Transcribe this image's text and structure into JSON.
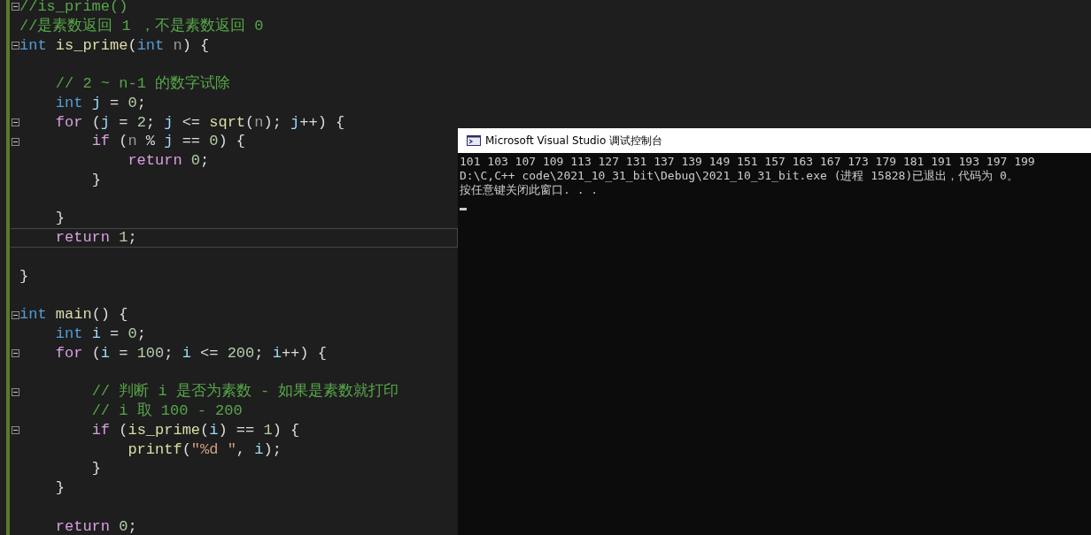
{
  "editor": {
    "lines": [
      {
        "fold": true,
        "current": false,
        "tokens": [
          {
            "kind": "comment",
            "text": "//is_prime()"
          }
        ]
      },
      {
        "fold": false,
        "current": false,
        "tokens": [
          {
            "kind": "comment",
            "text": "//是素数返回 1 ，不是素数返回 0"
          }
        ]
      },
      {
        "fold": true,
        "current": false,
        "tokens": [
          {
            "kind": "keyword",
            "text": "int"
          },
          {
            "kind": "function",
            "text": " is_prime"
          },
          {
            "kind": "plain",
            "text": "("
          },
          {
            "kind": "keyword",
            "text": "int"
          },
          {
            "kind": "param",
            "text": " n"
          },
          {
            "kind": "plain",
            "text": ") {"
          }
        ]
      },
      {
        "fold": false,
        "current": false
      },
      {
        "fold": false,
        "current": false,
        "tokens": [
          {
            "kind": "comment",
            "text": "    // 2 ~ n-1 的数字试除"
          }
        ]
      },
      {
        "fold": false,
        "current": false,
        "tokens": [
          {
            "kind": "keyword",
            "text": "    int"
          },
          {
            "kind": "variable",
            "text": " j"
          },
          {
            "kind": "plain",
            "text": " = "
          },
          {
            "kind": "number",
            "text": "0"
          },
          {
            "kind": "plain",
            "text": ";"
          }
        ]
      },
      {
        "fold": true,
        "current": false,
        "tokens": [
          {
            "kind": "control",
            "text": "    for"
          },
          {
            "kind": "plain",
            "text": " ("
          },
          {
            "kind": "variable",
            "text": "j"
          },
          {
            "kind": "plain",
            "text": " = "
          },
          {
            "kind": "number",
            "text": "2"
          },
          {
            "kind": "plain",
            "text": "; "
          },
          {
            "kind": "variable",
            "text": "j"
          },
          {
            "kind": "plain",
            "text": " <= "
          },
          {
            "kind": "function",
            "text": "sqrt"
          },
          {
            "kind": "plain",
            "text": "("
          },
          {
            "kind": "param",
            "text": "n"
          },
          {
            "kind": "plain",
            "text": "); "
          },
          {
            "kind": "variable",
            "text": "j"
          },
          {
            "kind": "plain",
            "text": "++) {"
          }
        ]
      },
      {
        "fold": true,
        "current": false,
        "tokens": [
          {
            "kind": "control",
            "text": "        if"
          },
          {
            "kind": "plain",
            "text": " ("
          },
          {
            "kind": "param",
            "text": "n"
          },
          {
            "kind": "plain",
            "text": " % "
          },
          {
            "kind": "variable",
            "text": "j"
          },
          {
            "kind": "plain",
            "text": " == "
          },
          {
            "kind": "number",
            "text": "0"
          },
          {
            "kind": "plain",
            "text": ") {"
          }
        ]
      },
      {
        "fold": false,
        "current": false,
        "tokens": [
          {
            "kind": "control",
            "text": "            return"
          },
          {
            "kind": "number",
            "text": " 0"
          },
          {
            "kind": "plain",
            "text": ";"
          }
        ]
      },
      {
        "fold": false,
        "current": false,
        "tokens": [
          {
            "kind": "plain",
            "text": "        }"
          }
        ]
      },
      {
        "fold": false,
        "current": false
      },
      {
        "fold": false,
        "current": false,
        "tokens": [
          {
            "kind": "plain",
            "text": "    }"
          }
        ]
      },
      {
        "fold": false,
        "current": true,
        "tokens": [
          {
            "kind": "control",
            "text": "    return"
          },
          {
            "kind": "number",
            "text": " 1"
          },
          {
            "kind": "plain",
            "text": ";"
          }
        ]
      },
      {
        "fold": false,
        "current": false
      },
      {
        "fold": false,
        "current": false,
        "tokens": [
          {
            "kind": "plain",
            "text": "}"
          }
        ]
      },
      {
        "fold": false,
        "current": false
      },
      {
        "fold": true,
        "current": false,
        "tokens": [
          {
            "kind": "keyword",
            "text": "int"
          },
          {
            "kind": "function",
            "text": " main"
          },
          {
            "kind": "plain",
            "text": "() {"
          }
        ]
      },
      {
        "fold": false,
        "current": false,
        "tokens": [
          {
            "kind": "keyword",
            "text": "    int"
          },
          {
            "kind": "variable",
            "text": " i"
          },
          {
            "kind": "plain",
            "text": " = "
          },
          {
            "kind": "number",
            "text": "0"
          },
          {
            "kind": "plain",
            "text": ";"
          }
        ]
      },
      {
        "fold": true,
        "current": false,
        "tokens": [
          {
            "kind": "control",
            "text": "    for"
          },
          {
            "kind": "plain",
            "text": " ("
          },
          {
            "kind": "variable",
            "text": "i"
          },
          {
            "kind": "plain",
            "text": " = "
          },
          {
            "kind": "number",
            "text": "100"
          },
          {
            "kind": "plain",
            "text": "; "
          },
          {
            "kind": "variable",
            "text": "i"
          },
          {
            "kind": "plain",
            "text": " <= "
          },
          {
            "kind": "number",
            "text": "200"
          },
          {
            "kind": "plain",
            "text": "; "
          },
          {
            "kind": "variable",
            "text": "i"
          },
          {
            "kind": "plain",
            "text": "++) {"
          }
        ]
      },
      {
        "fold": false,
        "current": false
      },
      {
        "fold": true,
        "current": false,
        "tokens": [
          {
            "kind": "comment",
            "text": "        // 判断 i 是否为素数 - 如果是素数就打印"
          }
        ]
      },
      {
        "fold": false,
        "current": false,
        "tokens": [
          {
            "kind": "comment",
            "text": "        // i 取 100 - 200"
          }
        ]
      },
      {
        "fold": true,
        "current": false,
        "tokens": [
          {
            "kind": "control",
            "text": "        if"
          },
          {
            "kind": "plain",
            "text": " ("
          },
          {
            "kind": "function",
            "text": "is_prime"
          },
          {
            "kind": "plain",
            "text": "("
          },
          {
            "kind": "variable",
            "text": "i"
          },
          {
            "kind": "plain",
            "text": ") == "
          },
          {
            "kind": "number",
            "text": "1"
          },
          {
            "kind": "plain",
            "text": ") {"
          }
        ]
      },
      {
        "fold": false,
        "current": false,
        "tokens": [
          {
            "kind": "function",
            "text": "            printf"
          },
          {
            "kind": "plain",
            "text": "("
          },
          {
            "kind": "string",
            "text": "\"%d \""
          },
          {
            "kind": "plain",
            "text": ", "
          },
          {
            "kind": "variable",
            "text": "i"
          },
          {
            "kind": "plain",
            "text": ");"
          }
        ]
      },
      {
        "fold": false,
        "current": false,
        "tokens": [
          {
            "kind": "plain",
            "text": "        }"
          }
        ]
      },
      {
        "fold": false,
        "current": false,
        "tokens": [
          {
            "kind": "plain",
            "text": "    }"
          }
        ]
      },
      {
        "fold": false,
        "current": false
      },
      {
        "fold": false,
        "current": false,
        "tokens": [
          {
            "kind": "control",
            "text": "    return"
          },
          {
            "kind": "number",
            "text": " 0"
          },
          {
            "kind": "plain",
            "text": ";"
          }
        ]
      }
    ]
  },
  "console": {
    "title": "Microsoft Visual Studio 调试控制台",
    "output": [
      "101 103 107 109 113 127 131 137 139 149 151 157 163 167 173 179 181 191 193 197 199",
      "D:\\C,C++ code\\2021_10_31_bit\\Debug\\2021_10_31_bit.exe (进程 15828)已退出，代码为 0。",
      "按任意键关闭此窗口. . ."
    ]
  }
}
